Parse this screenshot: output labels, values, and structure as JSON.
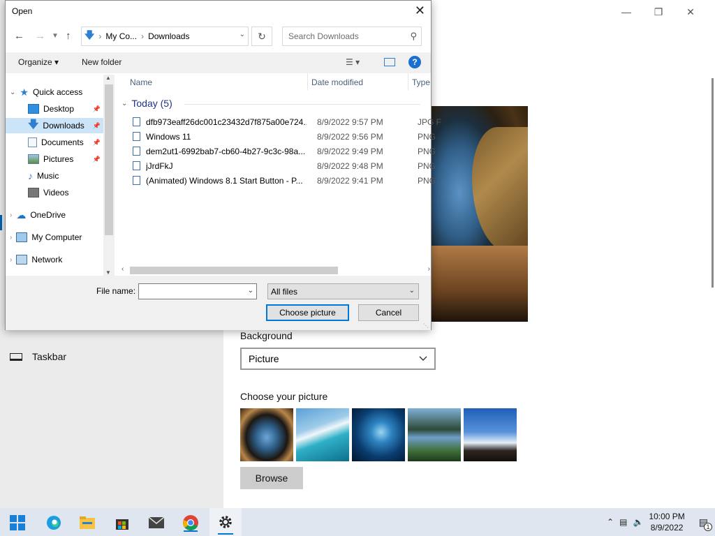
{
  "settings": {
    "nav_taskbar": "Taskbar",
    "background_label": "Background",
    "background_value": "Picture",
    "choose_label": "Choose your picture",
    "browse_label": "Browse",
    "window_controls": [
      "minimize-icon",
      "restore-icon",
      "close-icon"
    ]
  },
  "dialog": {
    "title": "Open",
    "breadcrumb": [
      "My Co...",
      "Downloads"
    ],
    "search_placeholder": "Search Downloads",
    "toolbar": {
      "organize": "Organize",
      "new_folder": "New folder"
    },
    "nav": [
      {
        "label": "Quick access",
        "icon": "star-icon",
        "expand": "expanded"
      },
      {
        "label": "Desktop",
        "icon": "desktop-icon",
        "pinned": true
      },
      {
        "label": "Downloads",
        "icon": "download-icon",
        "pinned": true,
        "selected": true
      },
      {
        "label": "Documents",
        "icon": "documents-icon",
        "pinned": true
      },
      {
        "label": "Pictures",
        "icon": "pictures-icon",
        "pinned": true
      },
      {
        "label": "Music",
        "icon": "music-icon"
      },
      {
        "label": "Videos",
        "icon": "videos-icon"
      },
      {
        "label": "OneDrive",
        "icon": "cloud-icon",
        "expand": "collapsed"
      },
      {
        "label": "My Computer",
        "icon": "computer-icon",
        "expand": "collapsed"
      },
      {
        "label": "Network",
        "icon": "network-icon",
        "expand": "collapsed"
      }
    ],
    "columns": [
      "Name",
      "Date modified",
      "Type"
    ],
    "group_label": "Today (5)",
    "files": [
      {
        "name": "dfb973eaff26dc001c23432d7f875a00e724...",
        "date": "8/9/2022 9:57 PM",
        "type": "JPG F"
      },
      {
        "name": "Windows 11",
        "date": "8/9/2022 9:56 PM",
        "type": "PNG"
      },
      {
        "name": "dem2ut1-6992bab7-cb60-4b27-9c3c-98a...",
        "date": "8/9/2022 9:49 PM",
        "type": "PNG"
      },
      {
        "name": "jJrdFkJ",
        "date": "8/9/2022 9:48 PM",
        "type": "PNG"
      },
      {
        "name": "(Animated) Windows 8.1 Start Button - P...",
        "date": "8/9/2022 9:41 PM",
        "type": "PNG"
      }
    ],
    "file_name_label": "File name:",
    "file_name_value": "",
    "file_type": "All files",
    "choose_button": "Choose picture",
    "cancel_button": "Cancel"
  },
  "taskbar": {
    "apps": [
      "start-icon",
      "edge-icon",
      "file-explorer-icon",
      "store-icon",
      "mail-icon",
      "chrome-icon",
      "settings-icon"
    ],
    "time": "10:00 PM",
    "date": "8/9/2022",
    "notification_count": "1"
  },
  "colors": {
    "accent": "#0078d7",
    "selected_nav": "#cce4f7",
    "settings_sidebar": "#ebebeb"
  }
}
